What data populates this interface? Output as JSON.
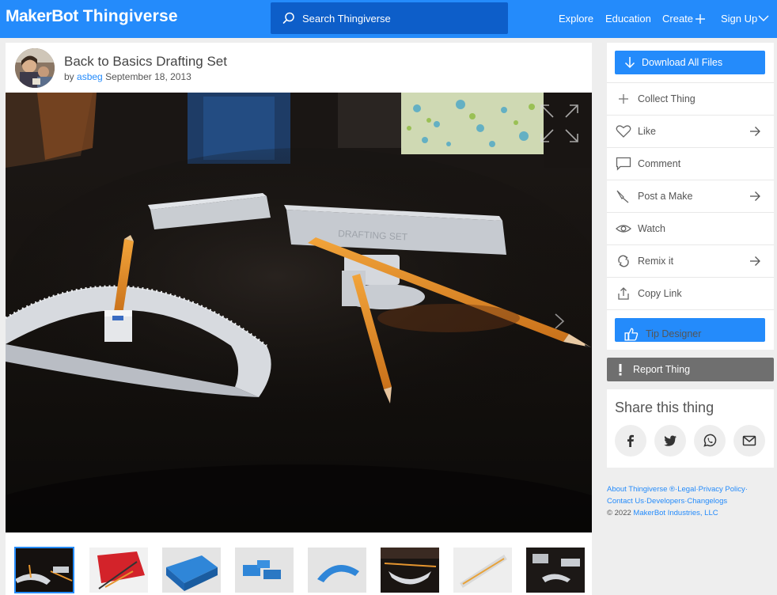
{
  "header": {
    "logo_part1": "MakerBot",
    "logo_part2": "Thingiverse",
    "search_placeholder": "Search Thingiverse",
    "nav": {
      "explore": "Explore",
      "education": "Education",
      "create": "Create",
      "signup": "Sign Up"
    }
  },
  "thing": {
    "title": "Back to Basics Drafting Set",
    "by": "by",
    "author": "asbeg",
    "date": "September 18, 2013"
  },
  "actions": {
    "download": "Download All Files",
    "collect": "Collect Thing",
    "like": "Like",
    "comment": "Comment",
    "post_make": "Post a Make",
    "watch": "Watch",
    "remix": "Remix it",
    "copy_link": "Copy Link",
    "tip": "Tip Designer",
    "report": "Report Thing"
  },
  "share": {
    "title": "Share this thing",
    "buttons": [
      "facebook-icon",
      "twitter-icon",
      "whatsapp-icon",
      "email-icon"
    ]
  },
  "footer": {
    "about": "About Thingiverse ®",
    "legal": "Legal",
    "privacy": "Privacy Policy",
    "contact": "Contact Us",
    "developers": "Developers",
    "changelogs": "Changelogs",
    "copyright": "© 2022",
    "company": "MakerBot Industries, LLC"
  },
  "thumbnails": {
    "count": 8,
    "active_index": 0
  },
  "colors": {
    "brand_blue": "#248bfb",
    "search_bg": "#0d5ec9",
    "report_gray": "#6f6f6f",
    "page_bg": "#eeeeee"
  }
}
